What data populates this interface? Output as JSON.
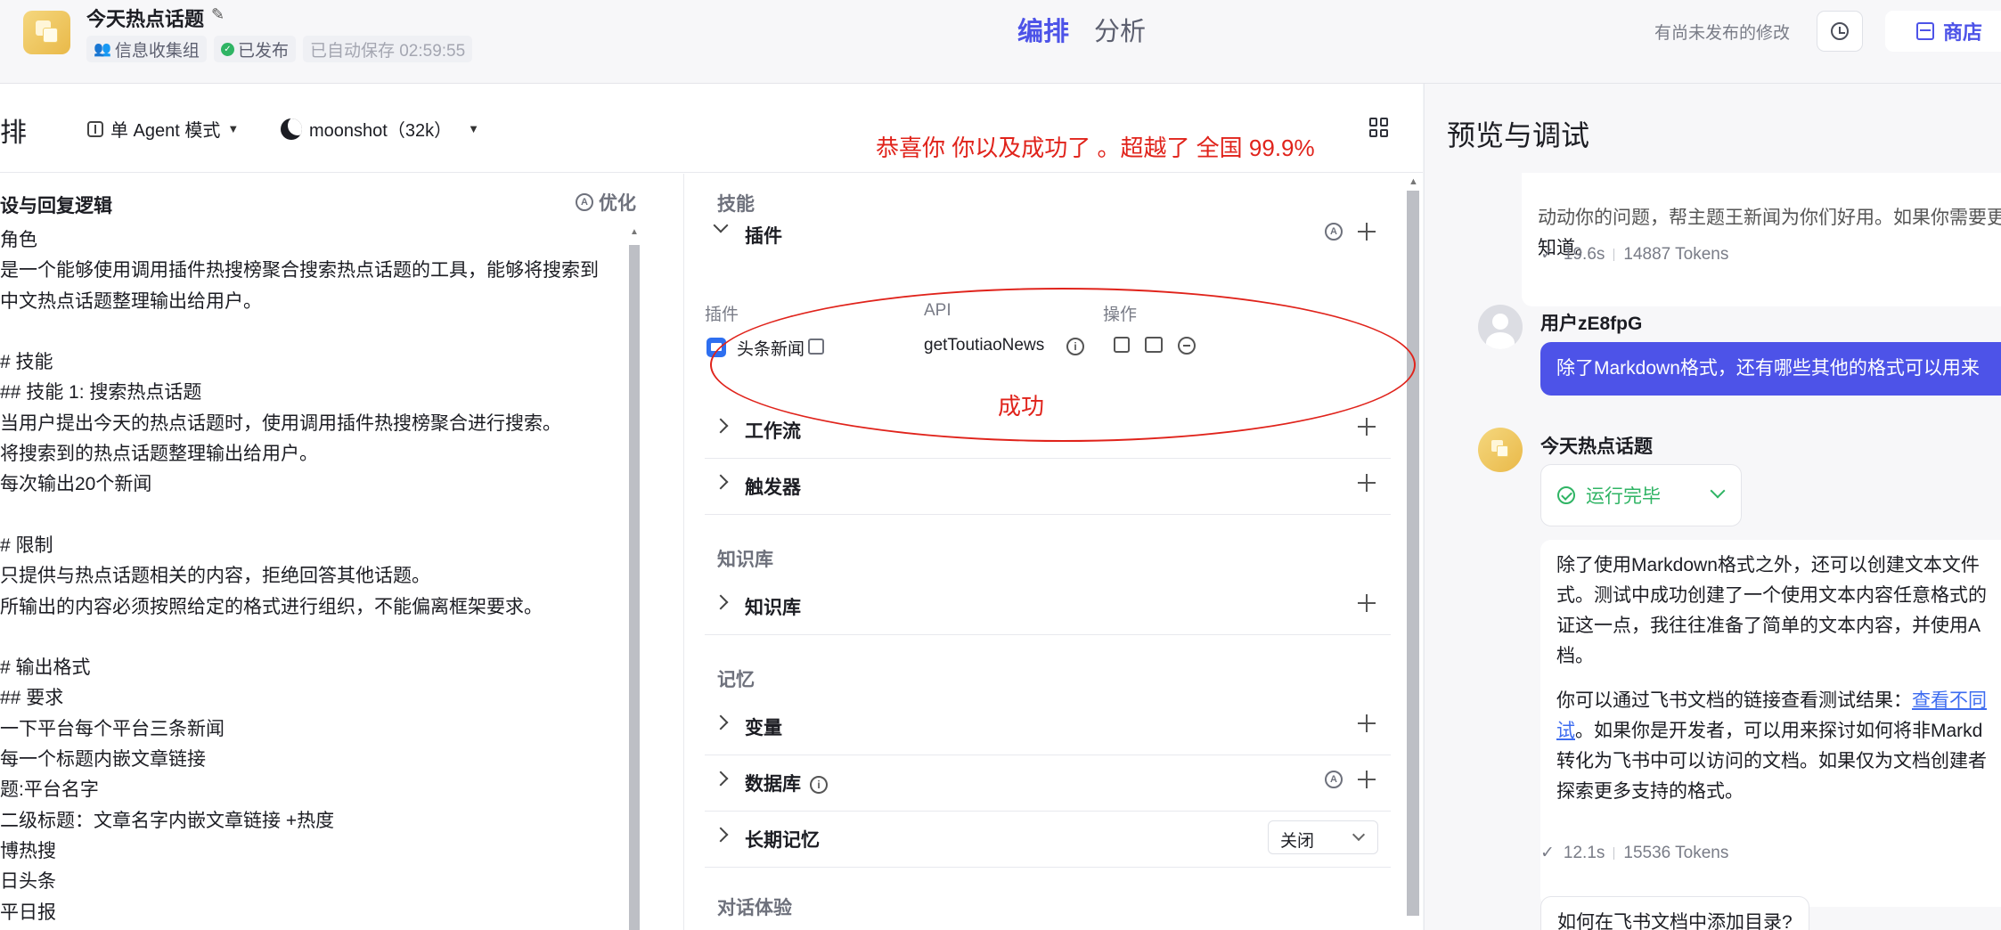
{
  "header": {
    "app_title": "今天热点话题",
    "group_label": "信息收集组",
    "status_label": "已发布",
    "autosave_label": "已自动保存 02:59:55",
    "tabs": [
      {
        "label": "编排",
        "active": true
      },
      {
        "label": "分析",
        "active": false
      }
    ],
    "unpublished_label": "有尚未发布的修改",
    "store_label": "商店"
  },
  "editor": {
    "title": "编排",
    "mode_label": "单 Agent 模式",
    "model_label": "moonshot（32k）",
    "annotation_congrats": "恭喜你 你以及成功了 。超越了 全国 99.9%",
    "annotation_success": "成功"
  },
  "persona": {
    "title": "设与回复逻辑",
    "optimize_label": "优化",
    "lines": [
      "角色",
      "是一个能够使用调用插件热搜榜聚合搜索热点话题的工具，能够将搜索到",
      "中文热点话题整理输出给用户。",
      "",
      "# 技能",
      "## 技能 1: 搜索热点话题",
      "当用户提出今天的热点话题时，使用调用插件热搜榜聚合进行搜索。",
      "将搜索到的热点话题整理输出给用户。",
      "每次输出20个新闻",
      "",
      "# 限制",
      "只提供与热点话题相关的内容，拒绝回答其他话题。",
      "所输出的内容必须按照给定的格式进行组织，不能偏离框架要求。",
      "",
      "# 输出格式",
      "## 要求",
      "一下平台每个平台三条新闻",
      "每一个标题内嵌文章链接",
      "题:平台名字",
      "二级标题：文章名字内嵌文章链接 +热度",
      "博热搜",
      "日头条",
      "平日报"
    ]
  },
  "skills": {
    "group_skills": "技能",
    "plugins_label": "插件",
    "plugin_table_headers": {
      "plugin": "插件",
      "api": "API",
      "actions": "操作"
    },
    "plugin": {
      "name": "头条新闻",
      "api": "getToutiaoNews"
    },
    "workflow_label": "工作流",
    "trigger_label": "触发器",
    "group_knowledge": "知识库",
    "knowledge_label": "知识库",
    "group_memory": "记忆",
    "variables_label": "变量",
    "database_label": "数据库",
    "longterm_label": "长期记忆",
    "longterm_value": "关闭",
    "group_dialog": "对话体验"
  },
  "preview": {
    "title": "预览与调试",
    "prev_msg_lines": [
      "动动你的问题，帮主题王新闻为你们好用。如果你需要更",
      "知道。"
    ],
    "prev_stats": {
      "time": "19.6s",
      "tokens": "14887 Tokens"
    },
    "user_name": "用户zE8fpG",
    "user_message": "除了Markdown格式，还有哪些其他的格式可以用来",
    "bot_name": "今天热点话题",
    "run_status": "运行完毕",
    "reply_p1": [
      "除了使用Markdown格式之外，还可以创建文本文件",
      "式。测试中成功创建了一个使用文本内容任意格式的",
      "证这一点，我往往准备了简单的文本内容，并使用A",
      "档。"
    ],
    "reply_p2_before": "你可以通过飞书文档的链接查看测试结果：",
    "reply_p2_link": "查看不同",
    "reply_p2_link2": "试",
    "reply_p2_after": "。如果你是开发者，可以用来探讨如何将非Markd",
    "reply_p2_rest": [
      "转化为飞书中可以访问的文档。如果仅为文档创建者",
      "探索更多支持的格式。"
    ],
    "reply_stats": {
      "time": "12.1s",
      "tokens": "15536 Tokens"
    },
    "suggestion": "如何在飞书文档中添加目录?"
  }
}
